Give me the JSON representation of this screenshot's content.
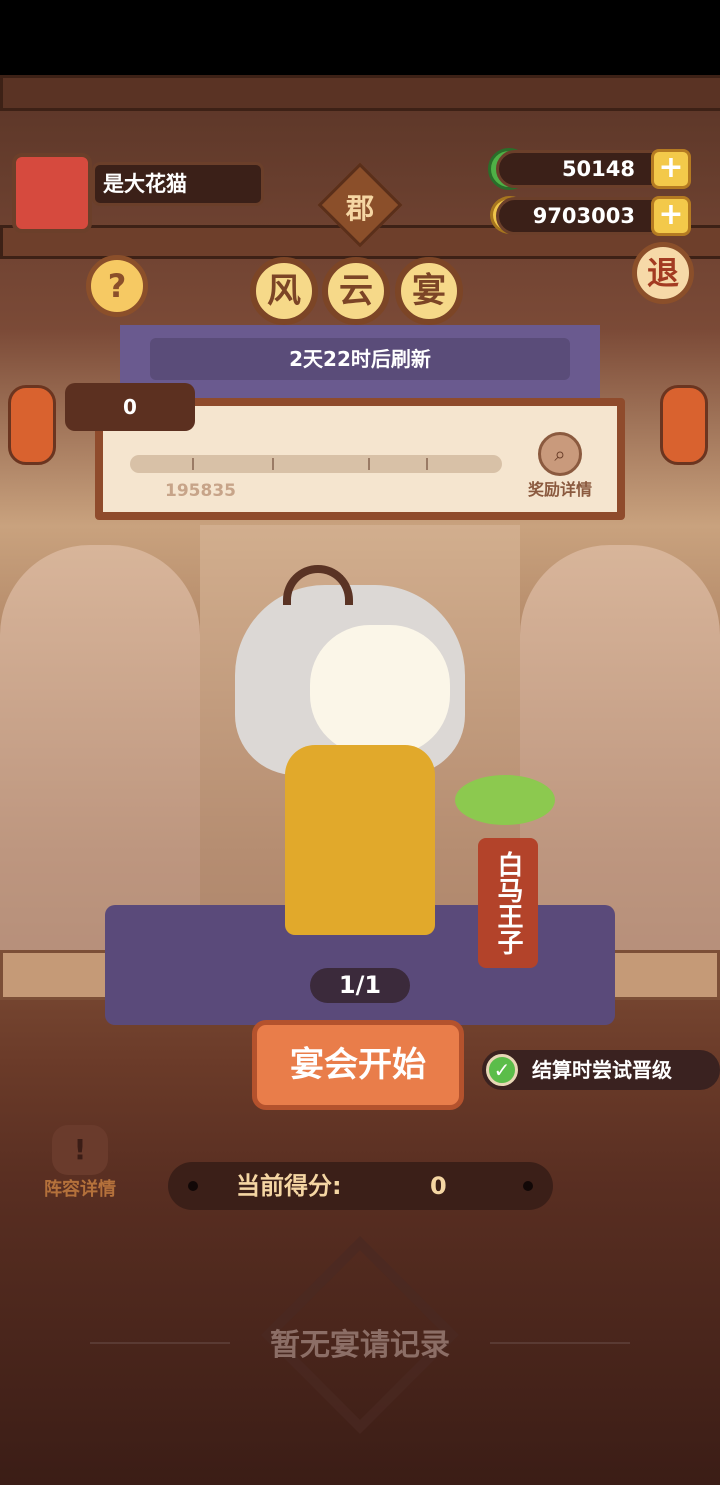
{
  "player": {
    "name": "是大花猫"
  },
  "currency": {
    "jade": "50148",
    "coins": "9703003",
    "plus": "+"
  },
  "header": {
    "rank_badge": "郡",
    "title_chars": [
      "风",
      "云",
      "宴"
    ],
    "help_icon": "?",
    "exit_label": "退",
    "refresh_text": "2天22时后刷新"
  },
  "progress": {
    "current_score": "0",
    "milestone": "195835",
    "reward_details": "奖励详情",
    "fill_fraction": 0
  },
  "character": {
    "name_banner": "白马王子",
    "counter": "1/1"
  },
  "actions": {
    "start_button": "宴会开始",
    "promote_checkbox_label": "结算时尝试晋级",
    "promote_checked": true,
    "lineup_details": "阵容详情",
    "lineup_icon": "!"
  },
  "score": {
    "label": "当前得分:",
    "value": "0"
  },
  "records": {
    "empty_text": "暂无宴请记录"
  }
}
